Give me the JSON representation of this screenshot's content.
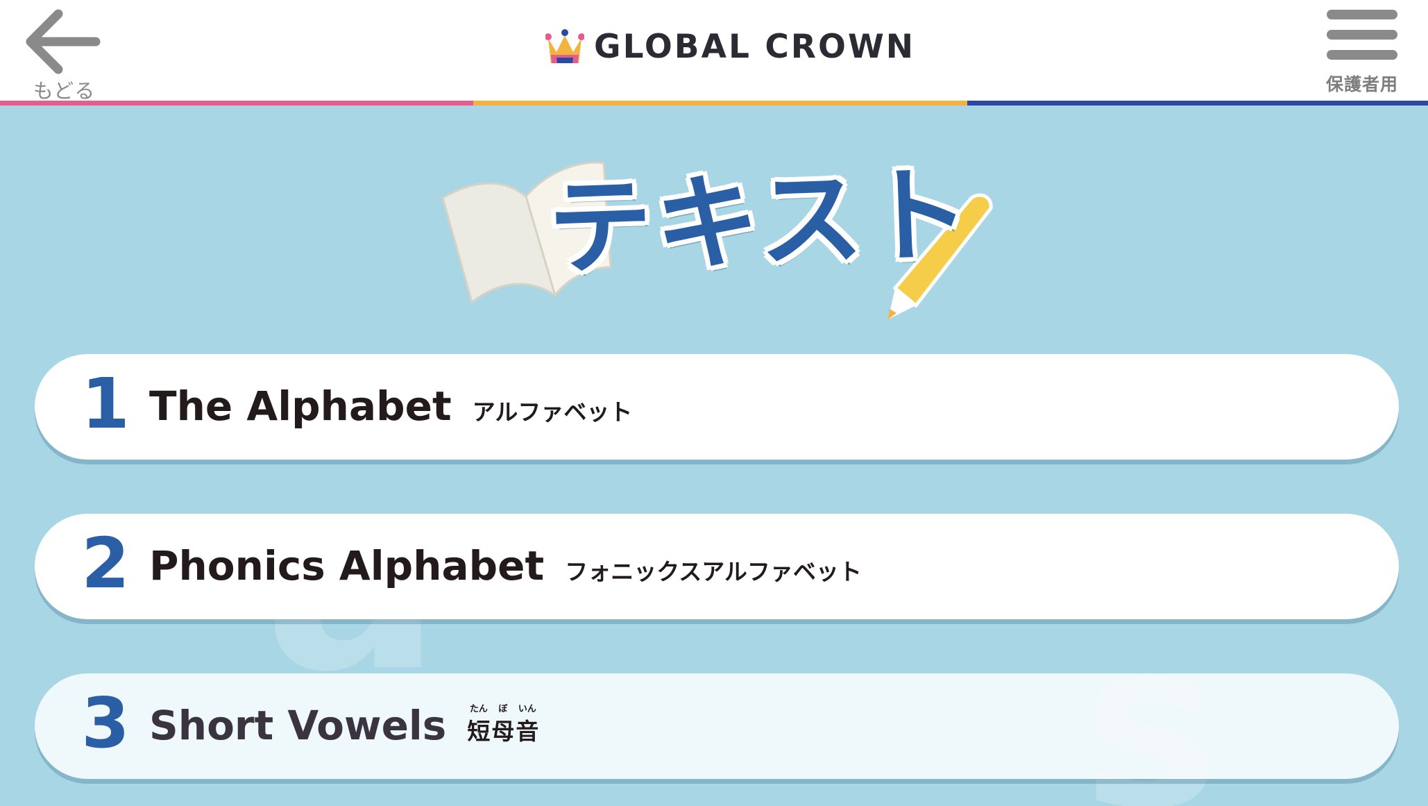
{
  "header": {
    "back_label": "もどる",
    "logo_text": "GLOBAL CROWN",
    "menu_label": "保護者用"
  },
  "stripes": [
    "#e45d8e",
    "#f2b340",
    "#2a49a3"
  ],
  "page_title": "テキスト",
  "lessons": [
    {
      "number": "1",
      "title": "The Alphabet",
      "subtitle": "アルファベット"
    },
    {
      "number": "2",
      "title": "Phonics Alphabet",
      "subtitle": "フォニックスアルファベット"
    },
    {
      "number": "3",
      "title": "Short Vowels",
      "subtitle_kanji": [
        "短",
        "母",
        "音"
      ],
      "subtitle_ruby": [
        "たん",
        "ぼ",
        "いん"
      ]
    }
  ],
  "colors": {
    "background": "#a8d6e4",
    "accent_blue": "#2a5ea5",
    "header_icon_gray": "#8a8a8a"
  },
  "icons": [
    "arrow-left-icon",
    "crown-logo-icon",
    "hamburger-menu-icon",
    "book-icon",
    "pencil-icon"
  ]
}
